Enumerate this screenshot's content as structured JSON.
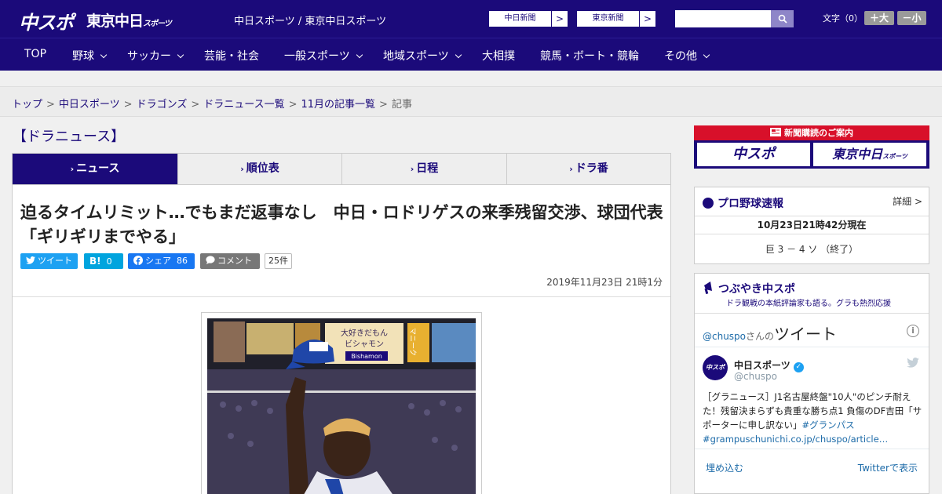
{
  "header": {
    "logo_main": "中スポ",
    "logo_tokyo": "東京中日",
    "logo_tokyo_small": "スポーツ",
    "site_link_1": "中日スポーツ",
    "site_link_sep": " / ",
    "site_link_2": "東京中日スポーツ",
    "ext_links": [
      {
        "label": "中日新聞",
        "arrow": ">"
      },
      {
        "label": "東京新聞",
        "arrow": ">"
      }
    ],
    "search_placeholder": "",
    "font_size_label": "文字（0）",
    "font_larger": "＋大",
    "font_smaller": "－小"
  },
  "nav": {
    "items": [
      {
        "label": "TOP",
        "has_dropdown": false
      },
      {
        "label": "野球",
        "has_dropdown": true
      },
      {
        "label": "サッカー",
        "has_dropdown": true
      },
      {
        "label": "芸能・社会",
        "has_dropdown": false
      },
      {
        "label": "一般スポーツ",
        "has_dropdown": true
      },
      {
        "label": "地域スポーツ",
        "has_dropdown": true
      },
      {
        "label": "大相撲",
        "has_dropdown": false
      },
      {
        "label": "競馬・ボート・競輪",
        "has_dropdown": false
      },
      {
        "label": "その他",
        "has_dropdown": true
      }
    ]
  },
  "breadcrumb": {
    "items": [
      "トップ",
      "中日スポーツ",
      "ドラゴンズ",
      "ドラニュース一覧",
      "11月の記事一覧",
      "記事"
    ],
    "separator": ">"
  },
  "section_title": "【ドラニュース】",
  "tabs": [
    {
      "label": "ニュース",
      "active": true
    },
    {
      "label": "順位表",
      "active": false
    },
    {
      "label": "日程",
      "active": false
    },
    {
      "label": "ドラ番",
      "active": false
    }
  ],
  "article": {
    "headline": "迫るタイムリミット…でもまだ返事なし　中日・ロドリゲスの来季残留交渉、球団代表「ギリギリまでやる」",
    "share": {
      "tweet": "ツイート",
      "hatena_icon": "B!",
      "hatena_count": "0",
      "facebook": "シェア",
      "facebook_count": "86",
      "comment": "コメント",
      "comment_count": "25件"
    },
    "date": "2019年11月23日 21時1分",
    "photo_sign_1": "大好きだもん",
    "photo_sign_2": "ビシャモン",
    "photo_sign_3": "Bishamon",
    "photo_sign_4": "マニーク"
  },
  "sidebar": {
    "subscribe_banner": {
      "title": "新聞購読のご案内",
      "brand_1": "中スポ",
      "brand_2": "東京中日",
      "brand_2_small": "スポーツ"
    },
    "baseball": {
      "title": "プロ野球速報",
      "detail_link": "詳細 >",
      "timestamp": "10月23日21時42分現在",
      "score_line": "巨 3 － 4 ソ （終了）"
    },
    "tweets": {
      "title": "つぶやき中スポ",
      "subtitle": "ドラ観戦の本紙評論家も語る。グラも熱烈応援",
      "account_handle": "@chuspo",
      "account_suffix": "さんの",
      "timeline_title": "ツイート",
      "info_icon": "i",
      "tweet": {
        "name": "中日スポーツ",
        "handle": "@chuspo",
        "avatar_text": "中スポ",
        "text": "［グラニュース］J1名古屋終盤\"10人\"のピンチ耐えた！残留決まらずも貴重な勝ち点1 負傷のDF吉田「サポーターに申し訳ない」",
        "hashtag": "#グランパス",
        "link": "#grampuschunichi.co.jp/chuspo/article…"
      },
      "embed": "埋め込む",
      "view_on_twitter": "Twitterで表示"
    }
  },
  "colors": {
    "brand_navy": "#1b0a7a",
    "twitter_blue": "#1da1f2",
    "hatena_blue": "#00a4de",
    "facebook_blue": "#1877f2",
    "comment_gray": "#777777",
    "banner_red": "#d8102a"
  }
}
